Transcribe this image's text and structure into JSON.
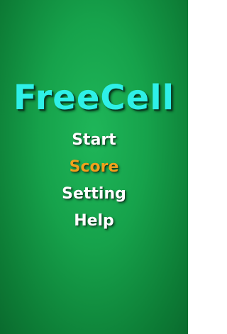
{
  "title": "FreeCell",
  "menu": {
    "items": [
      {
        "label": "Start"
      },
      {
        "label": "Score"
      },
      {
        "label": "Setting"
      },
      {
        "label": "Help"
      }
    ]
  },
  "colors": {
    "title": "#2ef0e8",
    "menu_text": "#ffffff",
    "menu_selected": "#f2a11c",
    "background": "#16a24b"
  }
}
